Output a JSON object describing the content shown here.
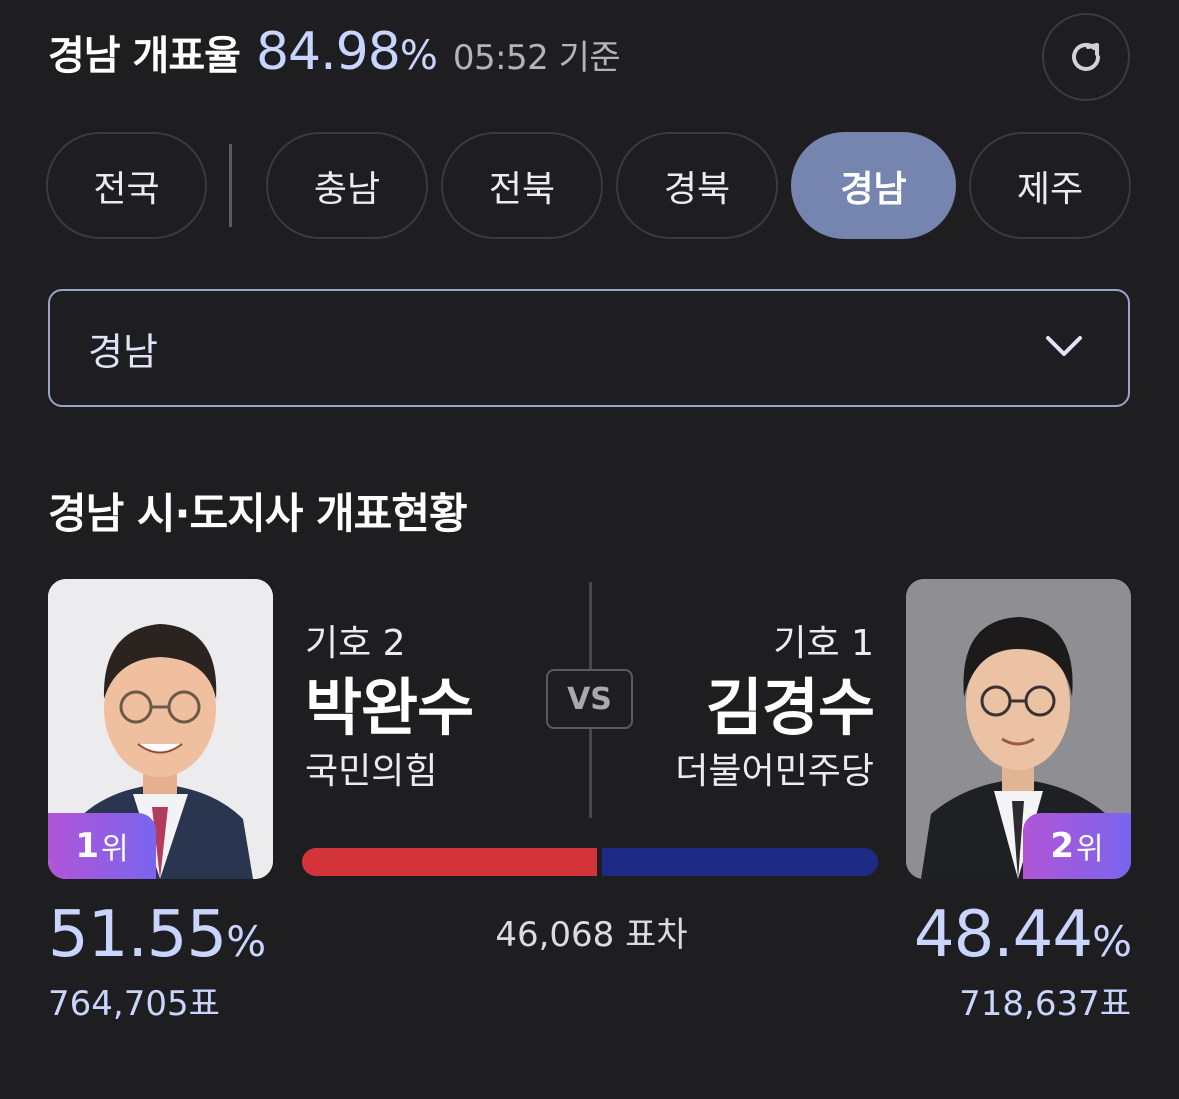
{
  "header": {
    "title": "경남 개표율",
    "rate": "84.98",
    "rate_unit": "%",
    "time": "05:52 기준"
  },
  "tabs": [
    {
      "label": "전국"
    },
    {
      "label": "충남"
    },
    {
      "label": "전북"
    },
    {
      "label": "경북"
    },
    {
      "label": "경남",
      "active": true
    },
    {
      "label": "제주"
    }
  ],
  "dropdown": {
    "selected": "경남"
  },
  "section_title": "경남 시·도지사 개표현황",
  "candidates": [
    {
      "number": "기호 2",
      "name": "박완수",
      "party": "국민의힘",
      "rank": "1",
      "rank_suffix": "위",
      "percent": "51.55",
      "unit": "%",
      "votes": "764,705표",
      "share": 51.55,
      "color": "#d3343a"
    },
    {
      "number": "기호 1",
      "name": "김경수",
      "party": "더불어민주당",
      "rank": "2",
      "rank_suffix": "위",
      "percent": "48.44",
      "unit": "%",
      "votes": "718,637표",
      "share": 48.44,
      "color": "#1d2b87"
    }
  ],
  "vs_label": "VS",
  "vote_difference": "46,068 표차",
  "colors": {
    "accent_rate": "#c9d4ff",
    "active_tab": "#7585b0",
    "rank_badge_start": "#b155d6",
    "rank_badge_end": "#7a65ef"
  },
  "icons": {
    "refresh": "refresh-icon",
    "dropdown": "chevron-down-icon"
  }
}
